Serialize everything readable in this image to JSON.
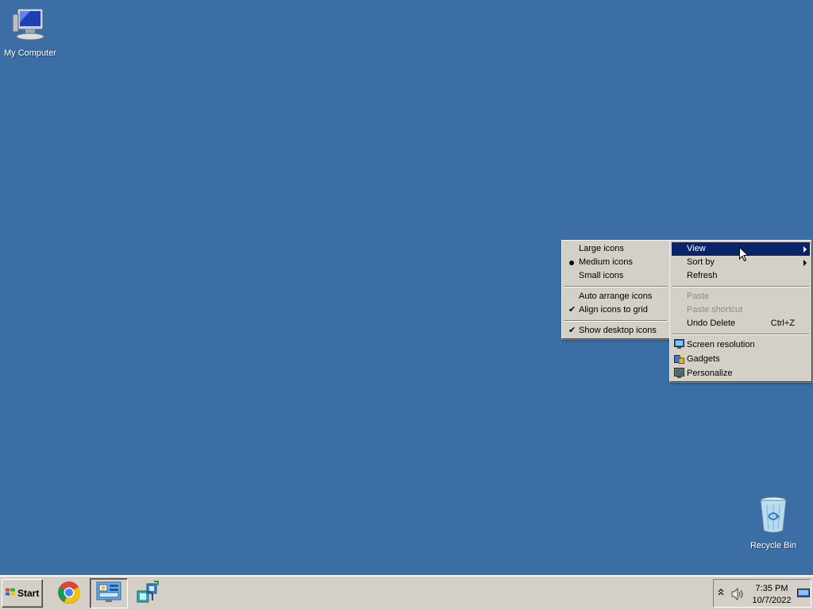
{
  "desktop": {
    "background_color": "#3a6ea5",
    "icons": [
      {
        "label": "My Computer",
        "icon": "computer-icon"
      },
      {
        "label": "Recycle Bin",
        "icon": "recycle-bin-icon"
      }
    ]
  },
  "context_menu": {
    "highlight_color": "#0a246a",
    "items": [
      {
        "label": "View",
        "submenu": true,
        "highlighted": true
      },
      {
        "label": "Sort by",
        "submenu": true
      },
      {
        "label": "Refresh"
      },
      {
        "label": "Paste",
        "disabled": true
      },
      {
        "label": "Paste shortcut",
        "disabled": true
      },
      {
        "label": "Undo Delete",
        "shortcut": "Ctrl+Z"
      },
      {
        "label": "Screen resolution",
        "icon": "monitor-icon"
      },
      {
        "label": "Gadgets",
        "icon": "gadgets-icon"
      },
      {
        "label": "Personalize",
        "icon": "personalize-icon"
      }
    ]
  },
  "view_submenu": {
    "items": [
      {
        "label": "Large icons"
      },
      {
        "label": "Medium icons",
        "selected": true,
        "mark": "bullet"
      },
      {
        "label": "Small icons"
      },
      {
        "label": "Auto arrange icons"
      },
      {
        "label": "Align icons to grid",
        "checked": true,
        "mark": "✔"
      },
      {
        "label": "Show desktop icons",
        "checked": true,
        "mark": "✔"
      }
    ]
  },
  "taskbar": {
    "start_label": "Start",
    "pinned": [
      {
        "name": "Google Chrome",
        "icon": "chrome-icon"
      },
      {
        "name": "Control Panel",
        "icon": "control-panel-icon",
        "active": true
      },
      {
        "name": "Network",
        "icon": "network-icon"
      }
    ],
    "tray": {
      "expand_glyph": "^",
      "volume_icon": "speaker-icon",
      "time": "7:35 PM",
      "date": "10/7/2022",
      "show_desktop_icon": "show-desktop-icon"
    }
  }
}
